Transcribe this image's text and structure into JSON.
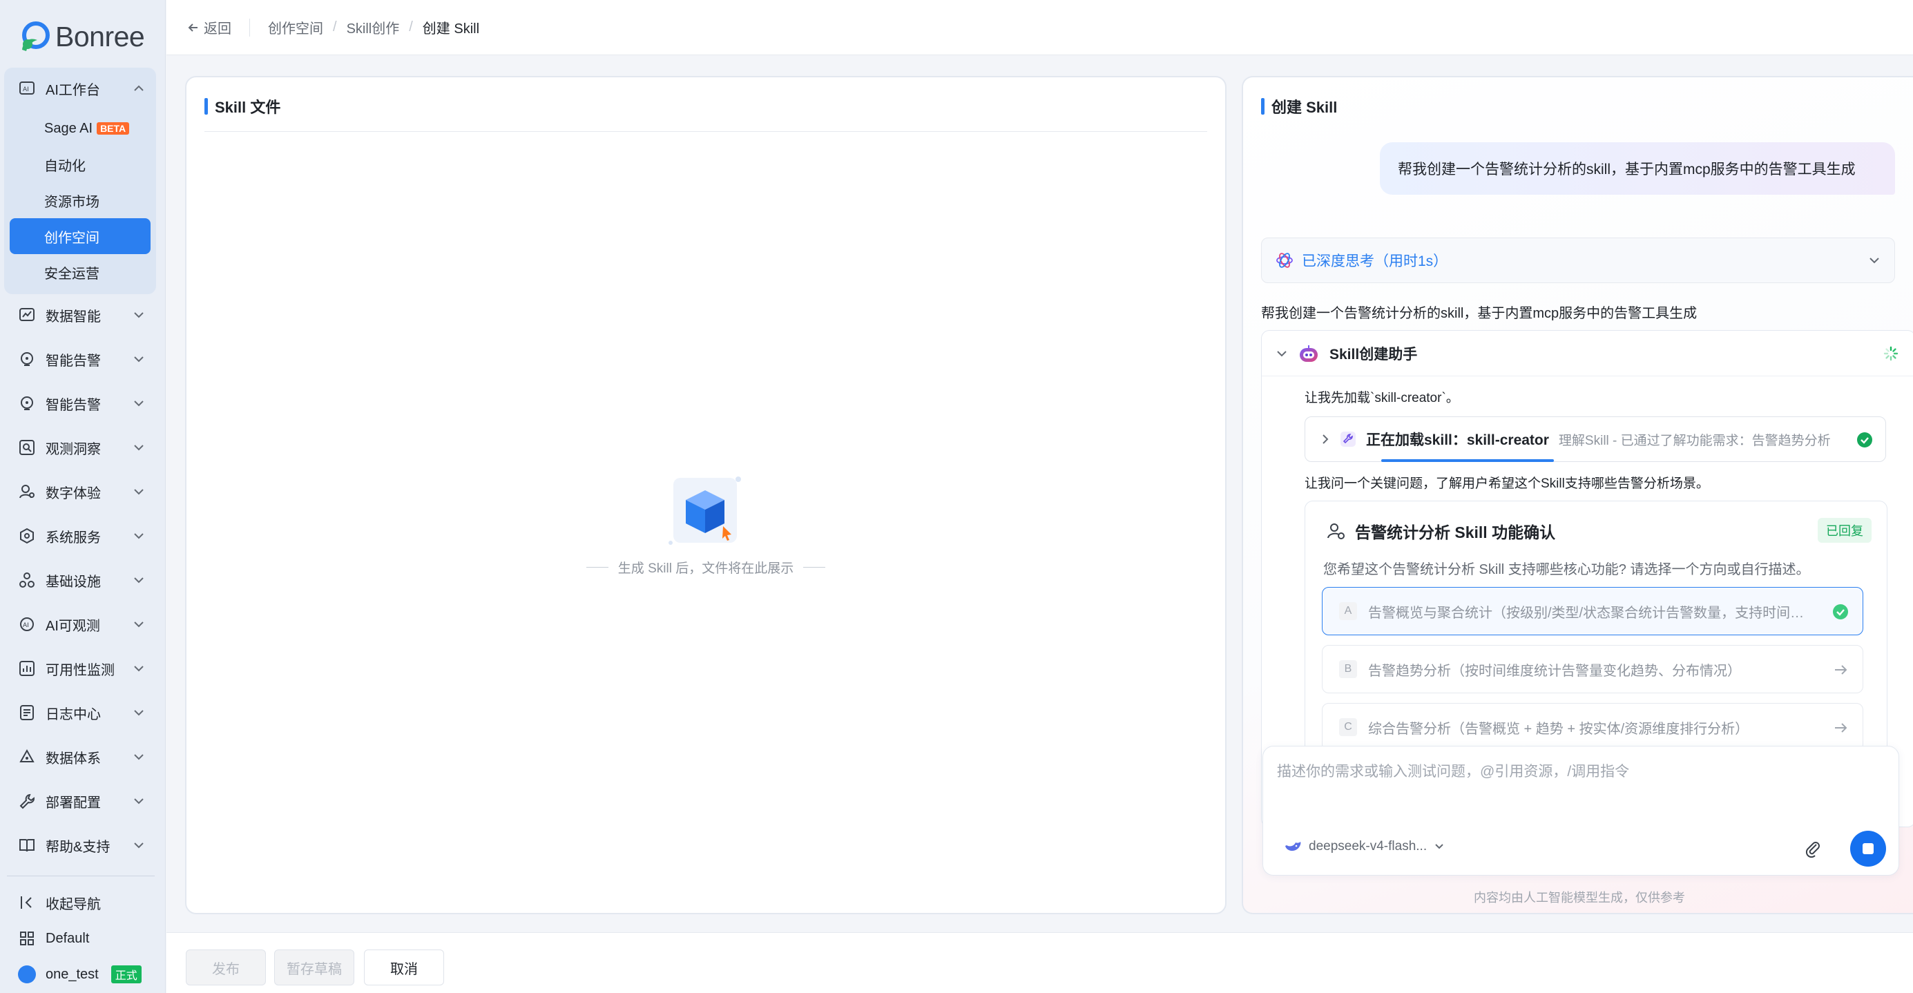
{
  "brand": {
    "name": "Bonree"
  },
  "sidebar": {
    "group": {
      "label": "AI工作台",
      "items": [
        {
          "label": "Sage AI",
          "badge": "BETA"
        },
        {
          "label": "自动化"
        },
        {
          "label": "资源市场"
        },
        {
          "label": "创作空间",
          "active": true
        },
        {
          "label": "安全运营"
        }
      ]
    },
    "items": [
      {
        "label": "数据智能",
        "icon": "chart-line-icon"
      },
      {
        "label": "智能告警",
        "icon": "alert-bulb-icon"
      },
      {
        "label": "智能告警",
        "icon": "alert-bulb-icon"
      },
      {
        "label": "观测洞察",
        "icon": "magnifier-icon"
      },
      {
        "label": "数字体验",
        "icon": "user-group-icon"
      },
      {
        "label": "系统服务",
        "icon": "network-icon"
      },
      {
        "label": "基础设施",
        "icon": "nodes-icon"
      },
      {
        "label": "AI可观测",
        "icon": "ai-monitor-icon"
      },
      {
        "label": "可用性监测",
        "icon": "availability-chart-icon"
      },
      {
        "label": "日志中心",
        "icon": "log-icon"
      },
      {
        "label": "数据体系",
        "icon": "data-system-icon"
      },
      {
        "label": "部署配置",
        "icon": "wrench-icon"
      },
      {
        "label": "帮助&支持",
        "icon": "book-icon"
      }
    ],
    "footer": {
      "collapse_label": "收起导航",
      "workspace_label": "Default",
      "user_label": "one_test",
      "user_badge": "正式"
    }
  },
  "topbar": {
    "back_label": "返回",
    "breadcrumb": [
      "创作空间",
      "Skill创作",
      "创建 Skill"
    ]
  },
  "left_panel": {
    "title": "Skill 文件",
    "empty_text": "生成 Skill 后，文件将在此展示"
  },
  "right_panel": {
    "title": "创建 Skill",
    "user_message": "帮我创建一个告警统计分析的skill，基于内置mcp服务中的告警工具生成",
    "thinking_label": "已深度思考（用时1s）",
    "reply_text": "帮我创建一个告警统计分析的skill，基于内置mcp服务中的告警工具生成",
    "agent": {
      "name": "Skill创建助手",
      "msg1": "让我先加载`skill-creator`。",
      "loading_title": "正在加载skill：skill-creator",
      "loading_desc": "理解Skill - 已通过了解功能需求：告警趋势分析",
      "msg2": "让我问一个关键问题，了解用户希望这个Skill支持哪些告警分析场景。",
      "question": {
        "title": "告警统计分析 Skill 功能确认",
        "status": "已回复",
        "subtitle": "您希望这个告警统计分析 Skill 支持哪些核心功能? 请选择一个方向或自行描述。",
        "options": [
          {
            "letter": "A",
            "text": "告警概览与聚合统计（按级别/类型/状态聚合统计告警数量，支持时间范围筛选）",
            "selected": true
          },
          {
            "letter": "B",
            "text": "告警趋势分析（按时间维度统计告警量变化趋势、分布情况）",
            "selected": false
          },
          {
            "letter": "C",
            "text": "综合告警分析（告警概览 + 趋势 + 按实体/资源维度排行分析）",
            "selected": false
          }
        ]
      }
    },
    "input": {
      "placeholder": "描述你的需求或输入测试问题，@引用资源，/调用指令",
      "value": ""
    },
    "model_label": "deepseek-v4-flash...",
    "disclaimer": "内容均由人工智能模型生成，仅供参考"
  },
  "footer": {
    "publish_label": "发布",
    "draft_label": "暂存草稿",
    "cancel_label": "取消"
  },
  "colors": {
    "accent": "#2b7ff0",
    "success": "#15a85a",
    "beta": "#ff6a2b"
  }
}
